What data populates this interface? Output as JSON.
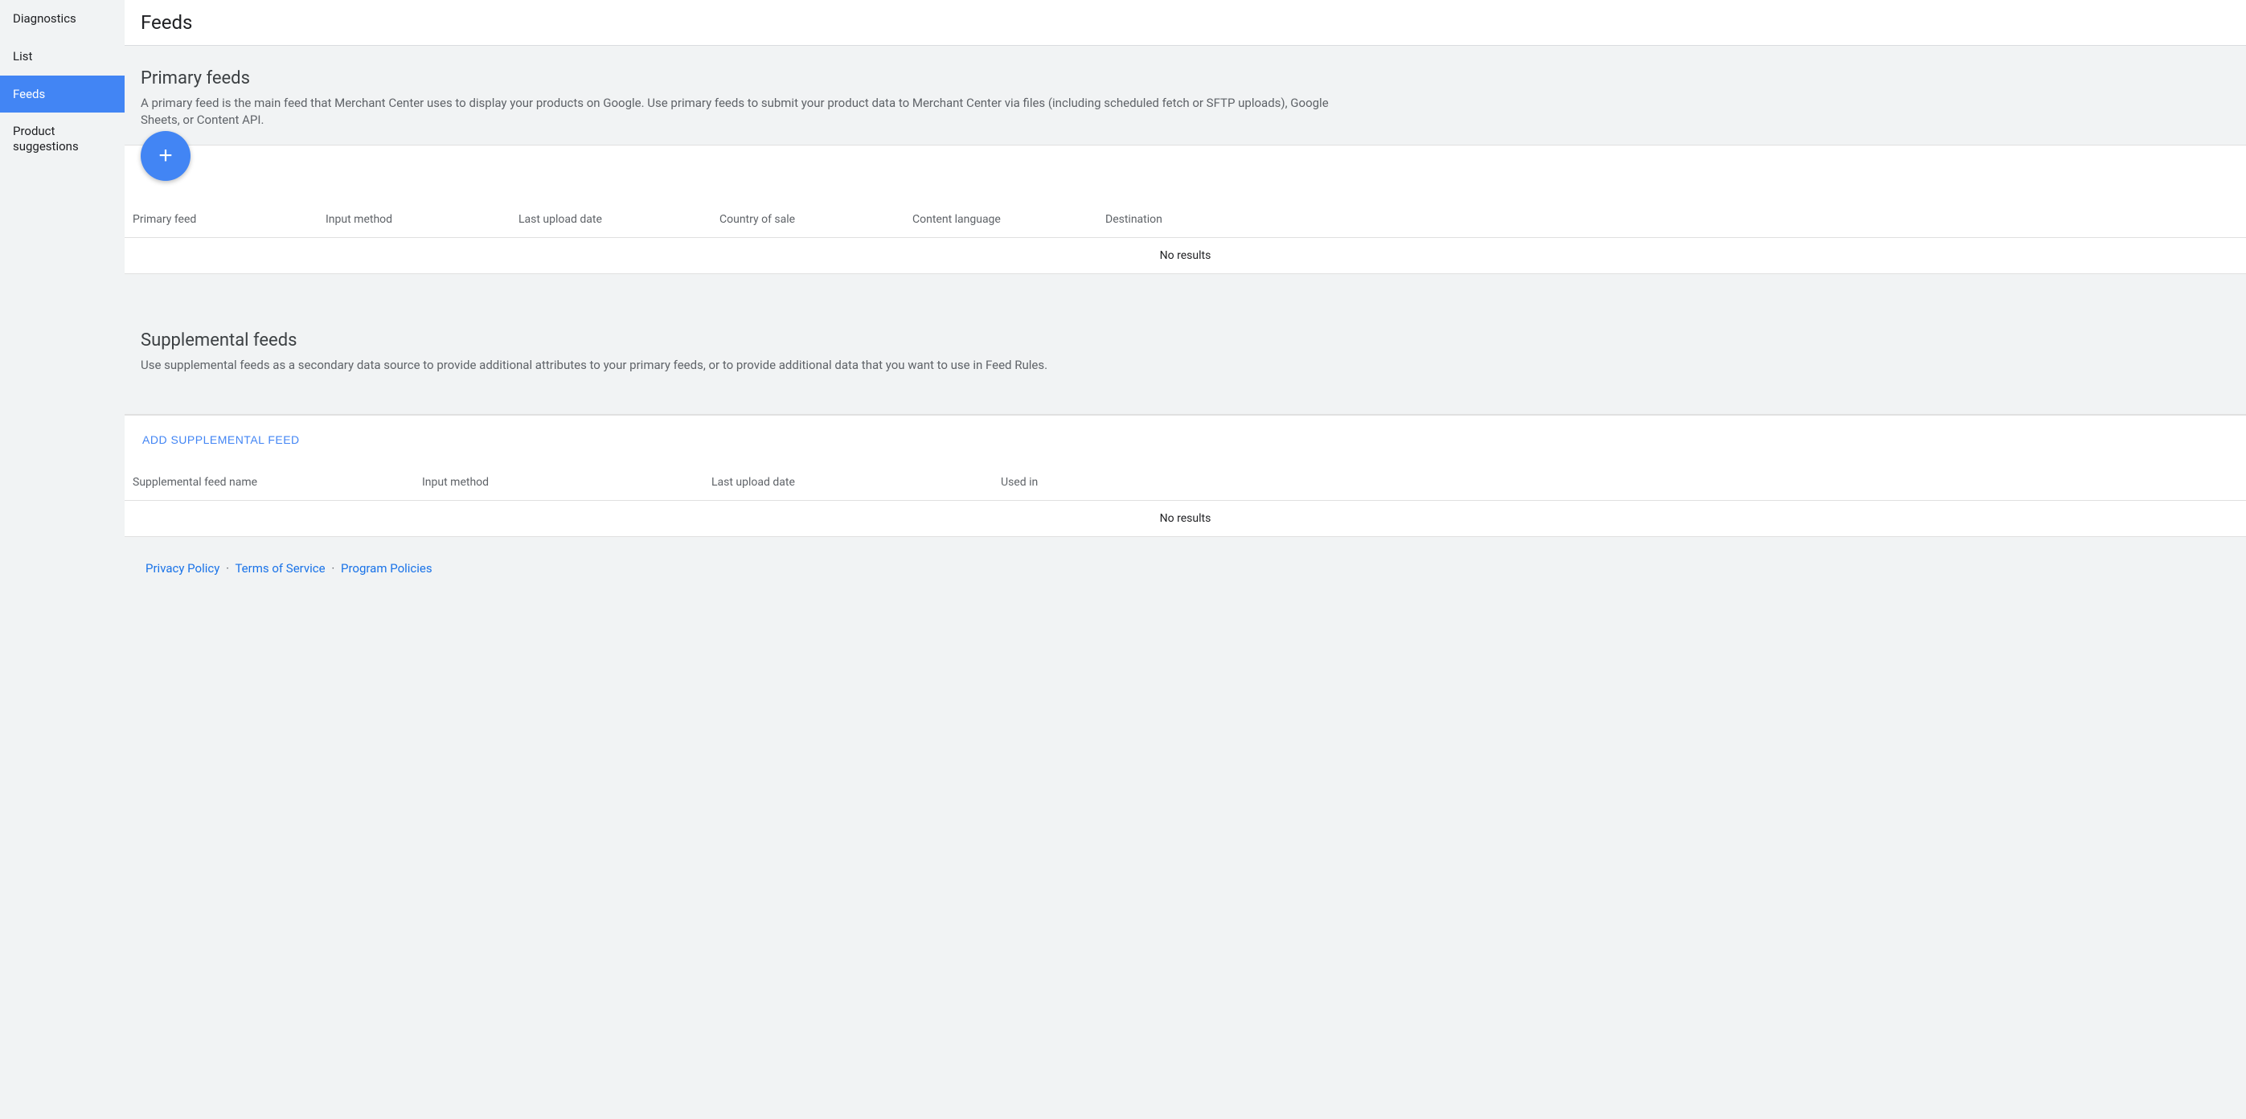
{
  "sidebar": {
    "items": [
      {
        "label": "Diagnostics",
        "active": false
      },
      {
        "label": "List",
        "active": false
      },
      {
        "label": "Feeds",
        "active": true
      },
      {
        "label": "Product suggestions",
        "active": false
      }
    ]
  },
  "header": {
    "title": "Feeds"
  },
  "primary": {
    "title": "Primary feeds",
    "description": "A primary feed is the main feed that Merchant Center uses to display your products on Google. Use primary feeds to submit your product data to Merchant Center via files (including scheduled fetch or SFTP uploads), Google Sheets, or Content API.",
    "fab_label": "+",
    "columns": [
      "Primary feed",
      "Input method",
      "Last upload date",
      "Country of sale",
      "Content language",
      "Destination"
    ],
    "empty_text": "No results"
  },
  "supplemental": {
    "title": "Supplemental feeds",
    "description": "Use supplemental feeds as a secondary data source to provide additional attributes to your primary feeds, or to provide additional data that you want to use in Feed Rules.",
    "add_label": "ADD SUPPLEMENTAL FEED",
    "columns": [
      "Supplemental feed name",
      "Input method",
      "Last upload date",
      "Used in"
    ],
    "empty_text": "No results"
  },
  "footer": {
    "links": [
      "Privacy Policy",
      "Terms of Service",
      "Program Policies"
    ],
    "separator": "·"
  }
}
